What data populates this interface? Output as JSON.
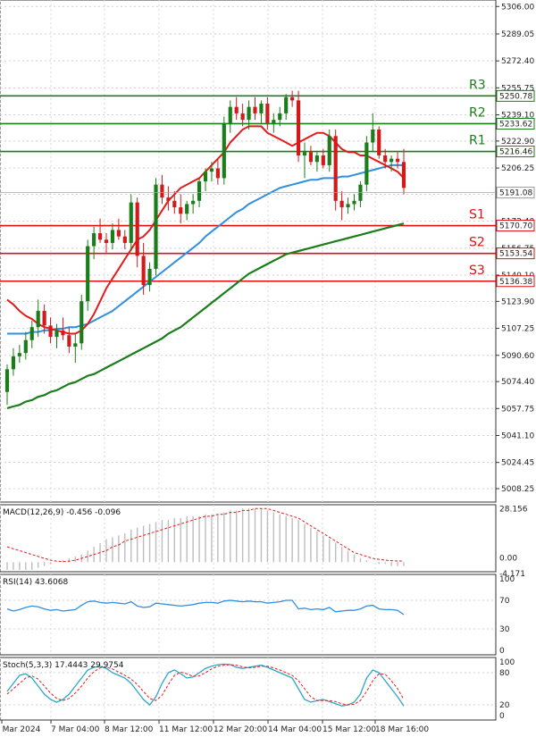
{
  "chart_data": {
    "type": "candlestick",
    "price": {
      "ylim": [
        5000,
        5310
      ],
      "y_ticks": [
        "5306.00",
        "5289.05",
        "5272.40",
        "5255.75",
        "5239.10",
        "5222.90",
        "5206.25",
        "5190.05",
        "5173.40",
        "5156.75",
        "5140.10",
        "5123.90",
        "5107.25",
        "5090.60",
        "5074.40",
        "5057.75",
        "5041.10",
        "5024.45",
        "5008.25"
      ],
      "last_price": "5191.08",
      "candles": [
        [
          5068,
          5085,
          5060,
          5082
        ],
        [
          5082,
          5095,
          5078,
          5090
        ],
        [
          5090,
          5097,
          5086,
          5092
        ],
        [
          5092,
          5105,
          5088,
          5100
        ],
        [
          5100,
          5112,
          5095,
          5108
        ],
        [
          5108,
          5125,
          5102,
          5118
        ],
        [
          5118,
          5122,
          5104,
          5109
        ],
        [
          5109,
          5114,
          5098,
          5102
        ],
        [
          5102,
          5110,
          5095,
          5106
        ],
        [
          5106,
          5114,
          5100,
          5103
        ],
        [
          5103,
          5108,
          5092,
          5096
        ],
        [
          5096,
          5104,
          5086,
          5098
        ],
        [
          5098,
          5128,
          5094,
          5124
        ],
        [
          5124,
          5162,
          5118,
          5158
        ],
        [
          5158,
          5170,
          5150,
          5166
        ],
        [
          5166,
          5175,
          5160,
          5162
        ],
        [
          5162,
          5166,
          5154,
          5160
        ],
        [
          5160,
          5172,
          5156,
          5168
        ],
        [
          5168,
          5175,
          5162,
          5164
        ],
        [
          5164,
          5168,
          5156,
          5160
        ],
        [
          5160,
          5190,
          5155,
          5185
        ],
        [
          5185,
          5188,
          5145,
          5152
        ],
        [
          5152,
          5160,
          5128,
          5134
        ],
        [
          5134,
          5148,
          5130,
          5144
        ],
        [
          5144,
          5200,
          5140,
          5196
        ],
        [
          5196,
          5202,
          5184,
          5188
        ],
        [
          5188,
          5195,
          5180,
          5186
        ],
        [
          5186,
          5192,
          5178,
          5182
        ],
        [
          5182,
          5190,
          5172,
          5178
        ],
        [
          5178,
          5186,
          5174,
          5184
        ],
        [
          5184,
          5190,
          5178,
          5186
        ],
        [
          5186,
          5200,
          5182,
          5198
        ],
        [
          5198,
          5206,
          5192,
          5204
        ],
        [
          5204,
          5210,
          5198,
          5206
        ],
        [
          5206,
          5212,
          5196,
          5200
        ],
        [
          5200,
          5238,
          5196,
          5234
        ],
        [
          5234,
          5248,
          5228,
          5244
        ],
        [
          5244,
          5250,
          5236,
          5240
        ],
        [
          5240,
          5246,
          5232,
          5236
        ],
        [
          5236,
          5248,
          5230,
          5244
        ],
        [
          5244,
          5250,
          5236,
          5240
        ],
        [
          5240,
          5248,
          5234,
          5246
        ],
        [
          5246,
          5250,
          5230,
          5234
        ],
        [
          5234,
          5240,
          5228,
          5236
        ],
        [
          5236,
          5244,
          5232,
          5240
        ],
        [
          5240,
          5252,
          5236,
          5250
        ],
        [
          5250,
          5254,
          5244,
          5248
        ],
        [
          5248,
          5254,
          5210,
          5214
        ],
        [
          5214,
          5222,
          5200,
          5216
        ],
        [
          5216,
          5220,
          5208,
          5210
        ],
        [
          5210,
          5216,
          5204,
          5214
        ],
        [
          5214,
          5218,
          5206,
          5208
        ],
        [
          5208,
          5230,
          5204,
          5226
        ],
        [
          5226,
          5230,
          5180,
          5186
        ],
        [
          5186,
          5192,
          5174,
          5182
        ],
        [
          5182,
          5188,
          5178,
          5184
        ],
        [
          5184,
          5190,
          5180,
          5186
        ],
        [
          5186,
          5198,
          5182,
          5196
        ],
        [
          5196,
          5226,
          5192,
          5222
        ],
        [
          5222,
          5240,
          5216,
          5230
        ],
        [
          5230,
          5232,
          5212,
          5214
        ],
        [
          5214,
          5218,
          5206,
          5210
        ],
        [
          5210,
          5214,
          5204,
          5212
        ],
        [
          5212,
          5216,
          5206,
          5210
        ],
        [
          5210,
          5218,
          5190,
          5194
        ]
      ],
      "ma_fast": [
        5125,
        5122,
        5118,
        5115,
        5113,
        5110,
        5108,
        5107,
        5106,
        5105,
        5104,
        5104,
        5106,
        5110,
        5116,
        5124,
        5132,
        5138,
        5144,
        5150,
        5156,
        5162,
        5164,
        5168,
        5174,
        5180,
        5186,
        5190,
        5194,
        5196,
        5198,
        5200,
        5204,
        5208,
        5212,
        5216,
        5222,
        5226,
        5230,
        5232,
        5232,
        5232,
        5228,
        5226,
        5224,
        5222,
        5220,
        5222,
        5224,
        5226,
        5228,
        5228,
        5226,
        5222,
        5218,
        5216,
        5216,
        5214,
        5214,
        5212,
        5210,
        5208,
        5206,
        5204,
        5200
      ],
      "ma_mid": [
        5104,
        5104,
        5104,
        5104,
        5105,
        5105,
        5106,
        5106,
        5107,
        5107,
        5108,
        5108,
        5109,
        5110,
        5112,
        5114,
        5116,
        5118,
        5121,
        5124,
        5127,
        5130,
        5133,
        5136,
        5139,
        5142,
        5145,
        5148,
        5151,
        5154,
        5157,
        5160,
        5164,
        5167,
        5170,
        5173,
        5176,
        5179,
        5181,
        5184,
        5186,
        5188,
        5190,
        5192,
        5194,
        5195,
        5196,
        5197,
        5198,
        5199,
        5199,
        5200,
        5200,
        5200,
        5201,
        5201,
        5202,
        5203,
        5204,
        5205,
        5206,
        5207,
        5208,
        5208,
        5208
      ],
      "ma_slow": [
        5058,
        5059,
        5060,
        5062,
        5063,
        5065,
        5066,
        5068,
        5069,
        5071,
        5073,
        5074,
        5076,
        5078,
        5079,
        5081,
        5083,
        5085,
        5087,
        5089,
        5091,
        5093,
        5095,
        5097,
        5099,
        5101,
        5104,
        5106,
        5108,
        5111,
        5114,
        5117,
        5120,
        5123,
        5126,
        5129,
        5132,
        5135,
        5138,
        5141,
        5143,
        5145,
        5147,
        5149,
        5151,
        5153,
        5154,
        5155,
        5156,
        5157,
        5158,
        5159,
        5160,
        5161,
        5162,
        5163,
        5164,
        5165,
        5166,
        5167,
        5168,
        5169,
        5170,
        5171,
        5172
      ],
      "levels": [
        {
          "name": "R3",
          "value": 5250.78,
          "value_label": "5250.78",
          "color": "#1a7d1a"
        },
        {
          "name": "R2",
          "value": 5233.62,
          "value_label": "5233.62",
          "color": "#1a7d1a"
        },
        {
          "name": "R1",
          "value": 5216.46,
          "value_label": "5216.46",
          "color": "#1a7d1a"
        },
        {
          "name": "S1",
          "value": 5170.7,
          "value_label": "5170.70",
          "color": "#e01010"
        },
        {
          "name": "S2",
          "value": 5153.54,
          "value_label": "5153.54",
          "color": "#e01010"
        },
        {
          "name": "S3",
          "value": 5136.38,
          "value_label": "5136.38",
          "color": "#e01010"
        }
      ]
    },
    "x_labels": [
      "6 Mar 2024",
      "7 Mar 04:00",
      "8 Mar 12:00",
      "11 Mar 12:00",
      "12 Mar 20:00",
      "14 Mar 04:00",
      "15 Mar 12:00",
      "18 Mar 16:00"
    ],
    "macd": {
      "label": "MACD(12,26,9) -0.456 -0.096",
      "ticks": [
        "28.156",
        "0.00",
        "-4.171"
      ],
      "ylim": [
        -5,
        30
      ],
      "hist": [
        -4,
        -4,
        -4,
        -4,
        -4,
        -3,
        -2,
        -1,
        0,
        1,
        2,
        3,
        4,
        6,
        8,
        10,
        12,
        13,
        14,
        15,
        17,
        18,
        19,
        20,
        21,
        22,
        22,
        23,
        23,
        24,
        24,
        24,
        25,
        25,
        25,
        26,
        27,
        27,
        28,
        28,
        28,
        28,
        27,
        26,
        25,
        24,
        23,
        22,
        20,
        18,
        16,
        14,
        12,
        10,
        8,
        6,
        4,
        2,
        1,
        0,
        -1,
        -1,
        -2,
        -2,
        -2
      ],
      "signal": [
        8,
        7,
        6,
        5,
        4,
        3,
        2,
        1,
        0.5,
        0.3,
        0.5,
        1,
        2,
        3,
        4,
        5,
        6,
        8,
        9,
        11,
        12,
        13,
        14,
        15,
        16,
        17,
        18,
        19,
        20,
        21,
        22,
        23,
        24,
        24,
        25,
        25,
        26,
        26,
        27,
        27,
        28,
        28,
        28,
        27,
        26,
        25,
        24,
        23,
        21,
        19,
        17,
        15,
        13,
        11,
        9,
        7,
        5,
        4,
        3,
        2,
        1.5,
        1,
        0.8,
        0.6,
        0.5
      ]
    },
    "rsi": {
      "label": "RSI(14) 43.6068",
      "ticks": [
        "100",
        "70",
        "30",
        "0"
      ],
      "ylim": [
        0,
        100
      ],
      "values": [
        58,
        55,
        57,
        60,
        62,
        61,
        58,
        56,
        57,
        55,
        56,
        57,
        63,
        68,
        69,
        67,
        66,
        67,
        66,
        65,
        68,
        62,
        60,
        61,
        66,
        65,
        64,
        63,
        62,
        63,
        64,
        66,
        67,
        67,
        66,
        69,
        70,
        69,
        68,
        69,
        68,
        68,
        66,
        67,
        68,
        70,
        70,
        58,
        59,
        57,
        58,
        57,
        60,
        54,
        55,
        56,
        56,
        58,
        62,
        63,
        58,
        57,
        57,
        56,
        50
      ]
    },
    "stoch": {
      "label": "Stoch(5,3,3) 17.4443 29.9754",
      "ticks": [
        "100",
        "80",
        "20",
        "0"
      ],
      "ylim": [
        0,
        100
      ],
      "k": [
        45,
        60,
        75,
        78,
        70,
        55,
        40,
        30,
        25,
        30,
        40,
        55,
        70,
        85,
        90,
        92,
        88,
        80,
        75,
        70,
        60,
        45,
        30,
        20,
        35,
        60,
        80,
        85,
        78,
        70,
        72,
        80,
        88,
        92,
        95,
        96,
        95,
        90,
        88,
        90,
        92,
        94,
        90,
        85,
        80,
        75,
        70,
        50,
        30,
        25,
        28,
        30,
        26,
        22,
        18,
        20,
        25,
        40,
        70,
        85,
        80,
        65,
        50,
        35,
        18
      ],
      "d": [
        40,
        50,
        60,
        70,
        74,
        68,
        55,
        42,
        32,
        28,
        32,
        42,
        55,
        70,
        82,
        89,
        90,
        87,
        81,
        75,
        68,
        58,
        45,
        32,
        28,
        38,
        58,
        75,
        81,
        78,
        73,
        74,
        80,
        87,
        92,
        94,
        95,
        94,
        91,
        89,
        90,
        92,
        92,
        89,
        85,
        80,
        75,
        65,
        50,
        35,
        28,
        28,
        28,
        26,
        22,
        20,
        21,
        28,
        45,
        65,
        78,
        77,
        65,
        50,
        30
      ]
    }
  }
}
